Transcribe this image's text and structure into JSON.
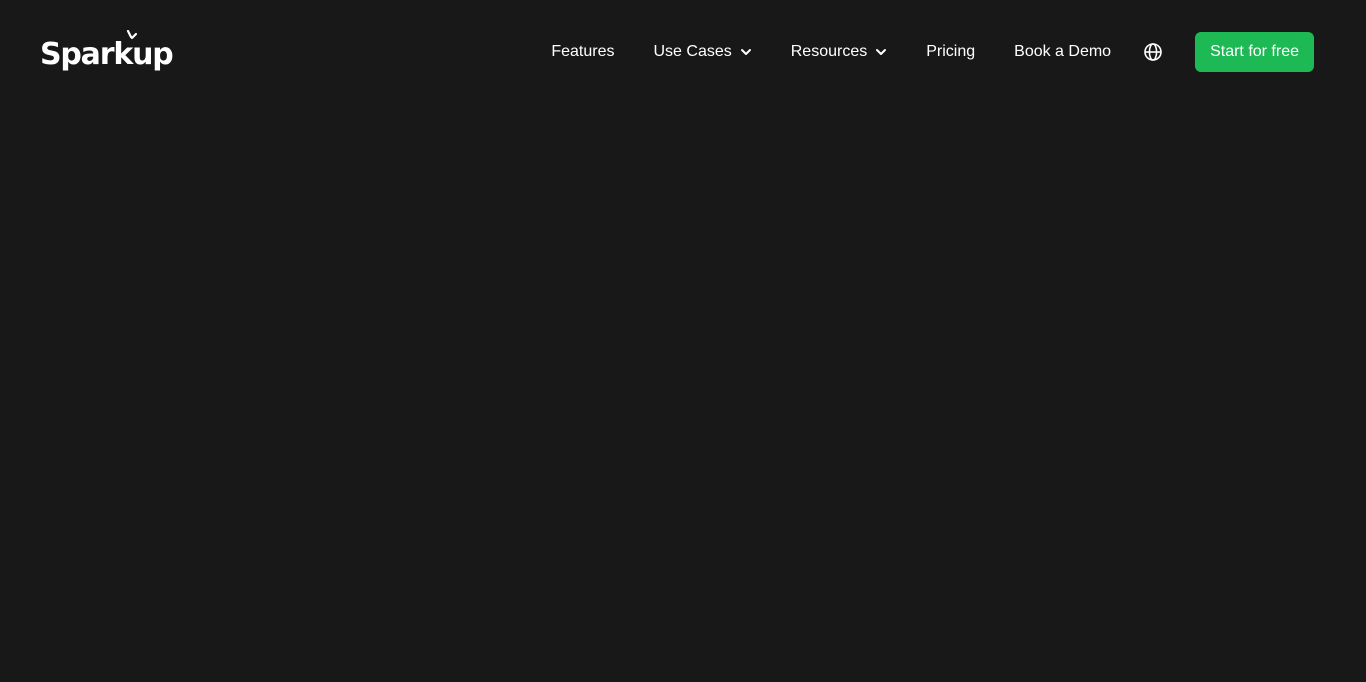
{
  "brand": {
    "name": "Sparkup",
    "accent_color": "#1db954",
    "background_color": "#181818"
  },
  "nav": {
    "items": [
      {
        "label": "Features",
        "has_dropdown": false
      },
      {
        "label": "Use Cases",
        "has_dropdown": true,
        "icon": "chevron-down-icon"
      },
      {
        "label": "Resources",
        "has_dropdown": true,
        "icon": "chevron-down-icon"
      },
      {
        "label": "Pricing",
        "has_dropdown": false
      },
      {
        "label": "Book a Demo",
        "has_dropdown": false
      }
    ],
    "language_icon": "globe-icon",
    "cta_label": "Start for free"
  }
}
